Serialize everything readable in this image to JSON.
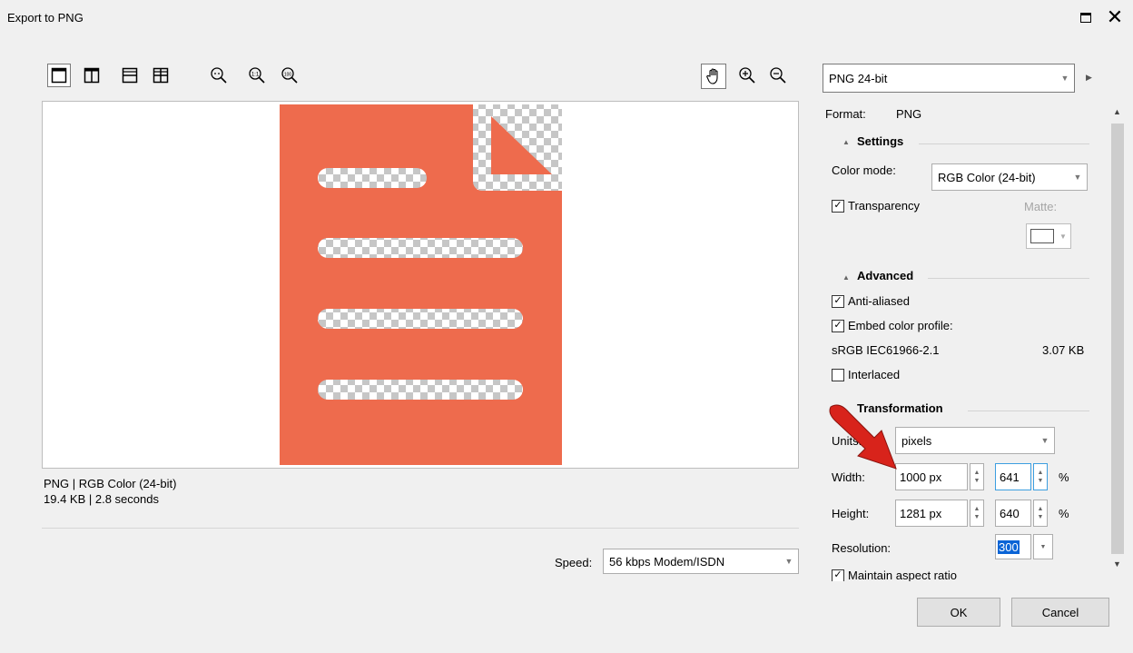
{
  "window": {
    "title": "Export to PNG"
  },
  "icons": {
    "view_single": "single-view-icon",
    "view_split_vertical": "split-vertical-view-icon",
    "view_split_horizontal": "split-horizontal-view-icon",
    "view_quad": "quad-view-icon",
    "zoom_fit": "zoom-fit-icon",
    "zoom_1to1": "zoom-1to1-icon",
    "zoom_100": "zoom-100-icon",
    "pan": "pan-hand-icon",
    "zoom_in": "zoom-in-icon",
    "zoom_out": "zoom-out-icon",
    "annotation": "red-arrow-annotation"
  },
  "toolbar": {
    "zoom_1to1_text": "1:1",
    "zoom_100_text": "100"
  },
  "colors": {
    "accent": "#ee6b4d",
    "annotation": "#d8231b",
    "selection": "#0a64d6"
  },
  "preview_info": {
    "line1": "PNG  |  RGB Color (24-bit)",
    "line2": "19.4 KB  |  2.8 seconds"
  },
  "speed": {
    "label": "Speed:",
    "value": "56 kbps Modem/ISDN"
  },
  "format_combo": {
    "value": "PNG 24-bit"
  },
  "panel": {
    "format_label": "Format:",
    "format_value": "PNG",
    "settings": {
      "heading": "Settings",
      "color_mode_label": "Color mode:",
      "color_mode_value": "RGB Color (24-bit)",
      "transparency_label": "Transparency",
      "transparency_checked": true,
      "matte_label": "Matte:"
    },
    "advanced": {
      "heading": "Advanced",
      "anti_aliased_label": "Anti-aliased",
      "embed_profile_label": "Embed color profile:",
      "profile_name": "sRGB IEC61966-2.1",
      "profile_size": "3.07 KB",
      "interlaced_label": "Interlaced"
    },
    "transformation": {
      "heading": "Transformation",
      "units_label": "Units:",
      "units_value": "pixels",
      "width_label": "Width:",
      "width_value": "1000 px",
      "width_percent": "641",
      "height_label": "Height:",
      "height_value": "1281 px",
      "height_percent": "640",
      "percent_sign": "%",
      "resolution_label": "Resolution:",
      "resolution_value": "300",
      "maintain_label": "Maintain aspect ratio"
    }
  },
  "buttons": {
    "ok": "OK",
    "cancel": "Cancel"
  }
}
